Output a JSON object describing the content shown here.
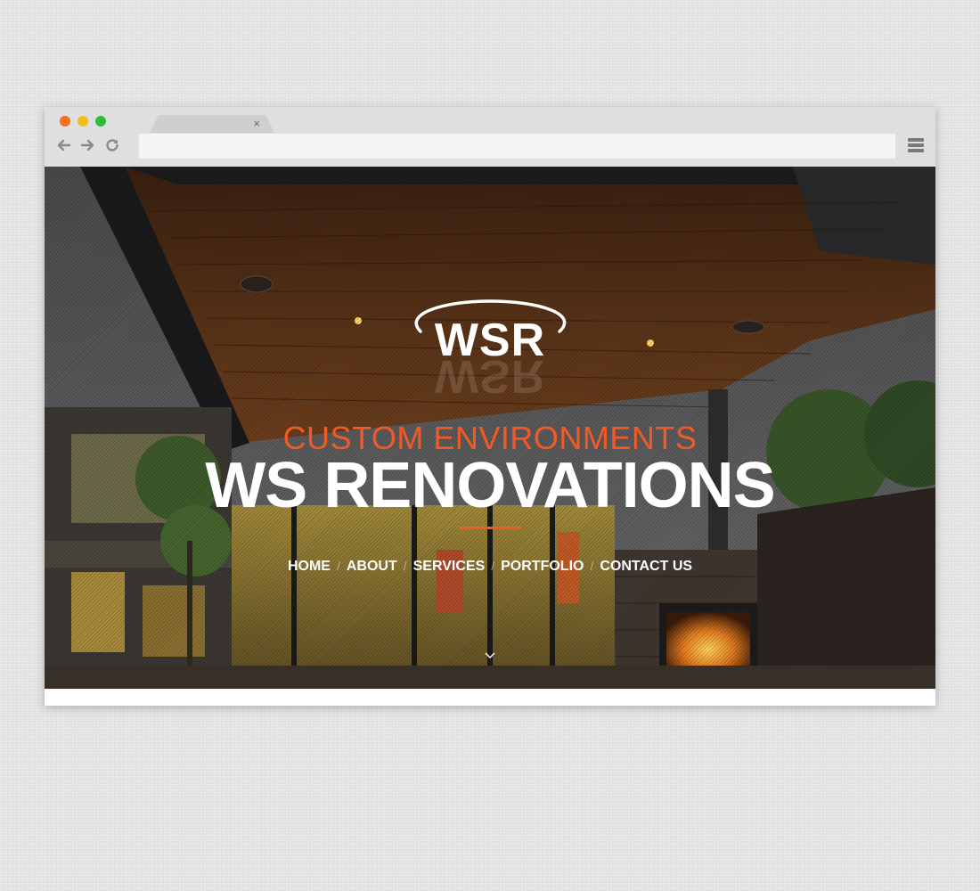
{
  "browser": {
    "window_controls": [
      "close",
      "minimize",
      "maximize"
    ],
    "tab": {
      "title": "",
      "close_label": "×"
    },
    "toolbar": {
      "back_icon": "arrow-left-icon",
      "forward_icon": "arrow-right-icon",
      "reload_icon": "reload-icon",
      "address": {
        "value": "",
        "placeholder": ""
      },
      "menu_icon": "hamburger-menu-icon"
    },
    "colors": {
      "close": "#f36f21",
      "minimize": "#f2bf1a",
      "maximize": "#2ebd3b"
    }
  },
  "hero": {
    "logo": "WSR",
    "tagline": "CUSTOM ENVIRONMENTS",
    "headline": "WS RENOVATIONS",
    "nav": [
      "HOME",
      "ABOUT",
      "SERVICES",
      "PORTFOLIO",
      "CONTACT US"
    ],
    "scroll_icon": "chevron-down-icon",
    "colors": {
      "accent": "#f15a24",
      "text": "#ffffff"
    }
  }
}
